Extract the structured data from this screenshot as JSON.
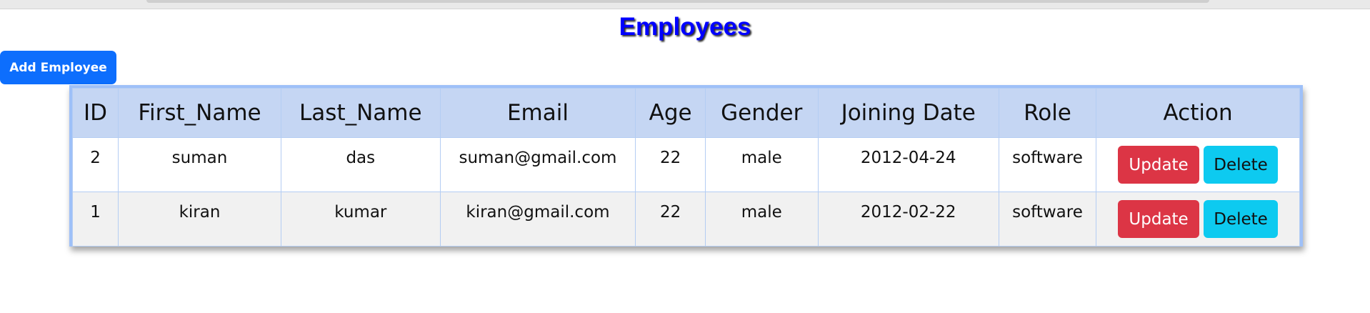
{
  "page": {
    "title": "Employees",
    "add_button_label": "Add Employee"
  },
  "table": {
    "headers": [
      "ID",
      "First_Name",
      "Last_Name",
      "Email",
      "Age",
      "Gender",
      "Joining Date",
      "Role",
      "Action"
    ],
    "rows": [
      {
        "id": "2",
        "first_name": "suman",
        "last_name": "das",
        "email": "suman@gmail.com",
        "age": "22",
        "gender": "male",
        "joining_date": "2012-04-24",
        "role": "software",
        "update_label": "Update",
        "delete_label": "Delete"
      },
      {
        "id": "1",
        "first_name": "kiran",
        "last_name": "kumar",
        "email": "kiran@gmail.com",
        "age": "22",
        "gender": "male",
        "joining_date": "2012-02-22",
        "role": "software",
        "update_label": "Update",
        "delete_label": "Delete"
      }
    ]
  },
  "colors": {
    "title": "#0000ff",
    "add_button": "#0d6efd",
    "update_button": "#dc3545",
    "delete_button": "#0dcaf0",
    "table_header": "#c5d6f3",
    "table_border": "#9ec0f8"
  }
}
